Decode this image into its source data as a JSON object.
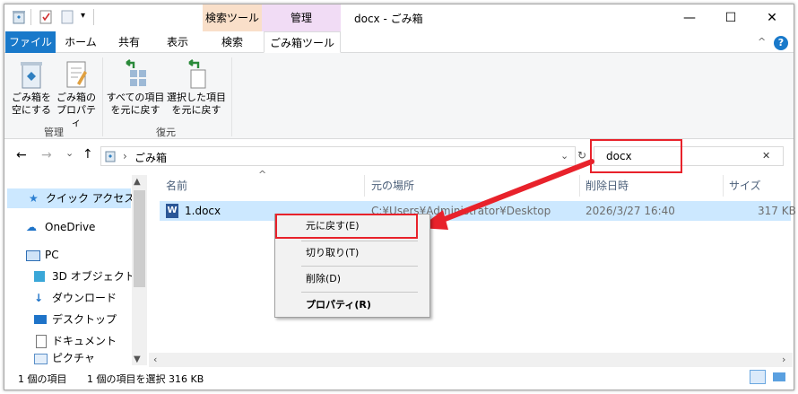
{
  "window": {
    "title": "docx - ごみ箱",
    "context_tabs": {
      "search_tools": "検索ツール",
      "manage": "管理"
    },
    "controls": {
      "minimize": "—",
      "maximize": "☐",
      "close": "✕"
    }
  },
  "ribbon": {
    "tabs": [
      "ファイル",
      "ホーム",
      "共有",
      "表示",
      "検索",
      "ごみ箱ツール"
    ],
    "groups": {
      "manage": {
        "label": "管理",
        "buttons": [
          {
            "line1": "ごみ箱を",
            "line2": "空にする"
          },
          {
            "line1": "ごみ箱の",
            "line2": "プロパティ"
          }
        ]
      },
      "restore": {
        "label": "復元",
        "buttons": [
          {
            "line1": "すべての項目",
            "line2": "を元に戻す"
          },
          {
            "line1": "選択した項目",
            "line2": "を元に戻す"
          }
        ]
      }
    }
  },
  "address_bar": {
    "nav": {
      "back": "←",
      "forward": "→",
      "recent": "⌄",
      "up": "↑"
    },
    "path_sep": "›",
    "path": "ごみ箱",
    "dropdown": "⌄",
    "refresh": "↻",
    "search_value": "docx",
    "search_clear": "✕"
  },
  "nav_pane": {
    "items": [
      {
        "label": "クイック アクセス",
        "icon": "star-icon"
      },
      {
        "label": "OneDrive",
        "icon": "cloud-icon"
      },
      {
        "label": "PC",
        "icon": "pc-icon"
      },
      {
        "label": "3D オブジェクト",
        "icon": "cube-icon"
      },
      {
        "label": "ダウンロード",
        "icon": "download-icon"
      },
      {
        "label": "デスクトップ",
        "icon": "desktop-icon"
      },
      {
        "label": "ドキュメント",
        "icon": "document-icon"
      },
      {
        "label": "ピクチャ",
        "icon": "picture-icon"
      }
    ]
  },
  "file_list": {
    "columns": [
      "名前",
      "元の場所",
      "削除日時",
      "サイズ"
    ],
    "sort_indicator": "^",
    "rows": [
      {
        "name": "1.docx",
        "location": "C:¥Users¥Administrator¥Desktop",
        "deleted": "2026/3/27 16:40",
        "size": "317 KB"
      }
    ]
  },
  "context_menu": {
    "items": [
      "元に戻す(E)",
      "切り取り(T)",
      "削除(D)",
      "プロパティ(R)"
    ]
  },
  "status_bar": {
    "item_count": "1 個の項目",
    "selection": "1 個の項目を選択 316 KB"
  },
  "colors": {
    "highlight": "#e8222b",
    "selection": "#cce8ff",
    "file_tab": "#1979ca"
  }
}
